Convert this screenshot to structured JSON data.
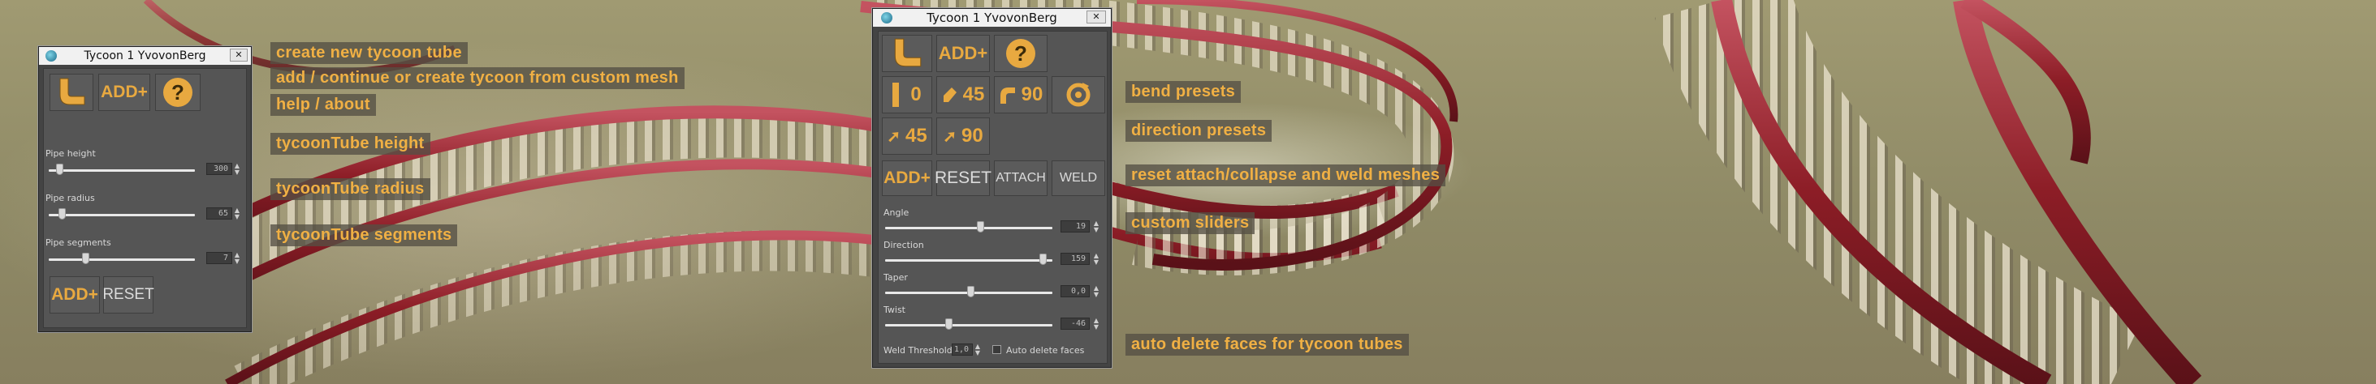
{
  "colors": {
    "accent": "#e8a940",
    "caption_text": "#f0b044",
    "window_bg": "#444444",
    "titlebar": "#f1f1f1",
    "track_red": "#8c1d26"
  },
  "window_small": {
    "title": "Tycoon 1 YvovonBerg",
    "close_label": "✕",
    "buttons": {
      "tube_icon": "tube-bend-icon",
      "add_label": "ADD+",
      "help_label": "?",
      "add2_label": "ADD+",
      "reset_label": "RESET"
    },
    "sliders": [
      {
        "label": "Pipe height",
        "value": "300",
        "level": 0.07
      },
      {
        "label": "Pipe radius",
        "value": "65",
        "level": 0.09
      },
      {
        "label": "Pipe segments",
        "value": "7",
        "level": 0.25
      }
    ]
  },
  "window_large": {
    "title": "Tycoon 1 YvovonBerg",
    "close_label": "✕",
    "buttons": {
      "add_label": "ADD+",
      "help_label": "?",
      "bend0": "0",
      "bend45": "45",
      "bend90": "90",
      "dir45": "45",
      "dir90": "90",
      "add2_label": "ADD+",
      "reset_label": "RESET",
      "attach_label": "ATTACH",
      "weld_label": "WELD"
    },
    "sliders": [
      {
        "label": "Angle",
        "value": "19",
        "level": 0.57
      },
      {
        "label": "Direction",
        "value": "159",
        "level": 0.94
      },
      {
        "label": "Taper",
        "value": "0,0",
        "level": 0.51
      },
      {
        "label": "Twist",
        "value": "-46",
        "level": 0.38
      }
    ],
    "weld_threshold_label": "Weld Threshold:",
    "weld_threshold_value": "1,0",
    "auto_delete_label": "Auto delete faces",
    "auto_delete_checked": false
  },
  "captions": {
    "c1": "create new tycoon tube",
    "c2": "add / continue or create tycoon from custom mesh",
    "c3": "help / about",
    "c4": "tycoonTube height",
    "c5": "tycoonTube radius",
    "c6": "tycoonTube segments",
    "c7": "bend presets",
    "c8": "direction presets",
    "c9": "reset attach/collapse and weld meshes",
    "c10": "custom sliders",
    "c11": "auto delete faces for tycoon tubes"
  }
}
